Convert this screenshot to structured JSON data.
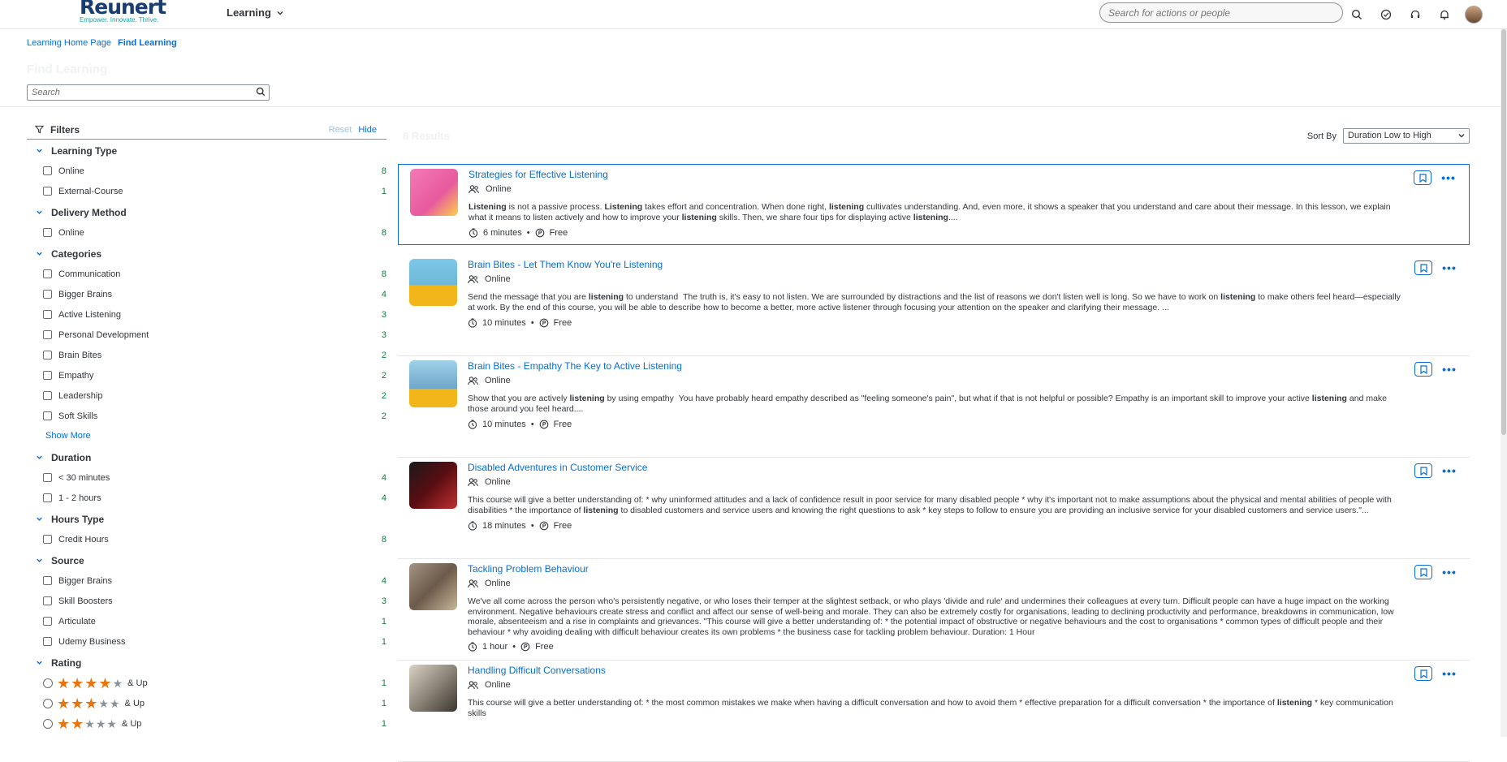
{
  "header": {
    "logo_word": "Reunert",
    "logo_tagline": "Empower. Innovate. Thrive.",
    "menu_label": "Learning",
    "search_placeholder": "Search for actions or people"
  },
  "breadcrumb": [
    "Learning Home Page",
    "Find Learning"
  ],
  "page_title": "Find Learning",
  "search": {
    "placeholder": "Search"
  },
  "filters": {
    "title": "Filters",
    "reset": "Reset",
    "hide": "Hide",
    "show_more": "Show More",
    "groups": [
      {
        "title": "Learning Type",
        "items": [
          {
            "label": "Online",
            "count": "8"
          },
          {
            "label": "External-Course",
            "count": "1"
          }
        ]
      },
      {
        "title": "Delivery Method",
        "items": [
          {
            "label": "Online",
            "count": "8"
          }
        ]
      },
      {
        "title": "Categories",
        "items": [
          {
            "label": "Communication",
            "count": "8"
          },
          {
            "label": "Bigger Brains",
            "count": "4"
          },
          {
            "label": "Active Listening",
            "count": "3"
          },
          {
            "label": "Personal Development",
            "count": "3"
          },
          {
            "label": "Brain Bites",
            "count": "2"
          },
          {
            "label": "Empathy",
            "count": "2"
          },
          {
            "label": "Leadership",
            "count": "2"
          },
          {
            "label": "Soft Skills",
            "count": "2"
          }
        ]
      },
      {
        "title": "Duration",
        "items": [
          {
            "label": "< 30 minutes",
            "count": "4"
          },
          {
            "label": "1 - 2 hours",
            "count": "4"
          }
        ]
      },
      {
        "title": "Hours Type",
        "items": [
          {
            "label": "Credit Hours",
            "count": "8"
          }
        ]
      },
      {
        "title": "Source",
        "items": [
          {
            "label": "Bigger Brains",
            "count": "4"
          },
          {
            "label": "Skill Boosters",
            "count": "3"
          },
          {
            "label": "Articulate",
            "count": "1"
          },
          {
            "label": "Udemy Business",
            "count": "1"
          }
        ]
      },
      {
        "title": "Rating",
        "items": [
          {
            "label": "& Up",
            "count": "1",
            "stars": 4
          },
          {
            "label": "& Up",
            "count": "1",
            "stars": 3
          },
          {
            "label": "& Up",
            "count": "1",
            "stars": 2
          }
        ]
      }
    ]
  },
  "results_count": "8 Results",
  "sort": {
    "label": "Sort By",
    "value": "Duration Low to High"
  },
  "results": [
    {
      "title": "Strategies for Effective Listening",
      "mode": "Online",
      "duration": "6 minutes",
      "price": "Free",
      "desc_html": "<b>Listening</b> is not a passive process. <b>Listening</b> takes effort and concentration. When done right, <b>listening</b> cultivates understanding. And, even more, it shows a speaker that you understand and care about their message. In this lesson, we explain what it means to listen actively and how to improve your <b>listening</b> skills. Then, we share four tips for displaying active <b>listening</b>...."
    },
    {
      "title": "Brain Bites - Let Them Know You're Listening",
      "mode": "Online",
      "duration": "10 minutes",
      "price": "Free",
      "desc_html": "Send the message that you are <b>listening</b> to understand &nbsp;The truth is, it's easy to not listen. We are surrounded by distractions and the list of reasons we don't listen well is long. So we have to work on <b>listening</b> to make others feel heard—especially at work. By the end of this course, you will be able to describe how to become a better, more active listener through focusing your attention on the speaker and clarifying their message. ..."
    },
    {
      "title": "Brain Bites - Empathy The Key to Active Listening",
      "mode": "Online",
      "duration": "10 minutes",
      "price": "Free",
      "desc_html": "Show that you are actively <b>listening</b> by using empathy &nbsp;You have probably heard empathy described as \"feeling someone's pain\", but what if that is not helpful or possible? Empathy is an important skill to improve your active <b>listening</b> and make those around you feel heard...."
    },
    {
      "title": "Disabled Adventures in Customer Service",
      "mode": "Online",
      "duration": "18 minutes",
      "price": "Free",
      "desc_html": "This course will give a better understanding of: * why uninformed attitudes and a lack of confidence result in poor service for many disabled people * why it's important not to make assumptions about the physical and mental abilities of people with disabilities * the importance of <b>listening</b> to disabled customers and service users and knowing the right questions to ask * key steps to follow to ensure you are providing an inclusive service for your disabled customers and service users.\"..."
    },
    {
      "title": "Tackling Problem Behaviour",
      "mode": "Online",
      "duration": "1 hour",
      "price": "Free",
      "desc_html": "We've all come across the person who's persistently negative, or who loses their temper at the slightest setback, or who plays 'divide and rule' and undermines their colleagues at every turn. Difficult people can have a huge impact on the working environment. Negative behaviours create stress and conflict and affect our sense of well-being and morale. They can also be extremely costly for organisations, leading to declining productivity and performance, breakdowns in communication, low morale, absenteeism and a rise in complaints and grievances. \"This course will give a better understanding of: * the potential impact of obstructive or negative behaviours and the cost to organisations * common types of difficult people and their behaviour * why avoiding dealing with difficult behaviour creates its own problems * the business case for tackling problem behaviour. Duration: 1 Hour"
    },
    {
      "title": "Handling Difficult Conversations",
      "mode": "Online",
      "duration": "",
      "price": "",
      "desc_html": "This course will give a better understanding of: * the most common mistakes we make when having a difficult conversation and how to avoid them * effective preparation for a difficult conversation * the importance of <b>listening</b> * key communication skills"
    }
  ],
  "colors": {
    "accent": "#0a6ed1",
    "count_green": "#107e3e",
    "star": "#e9730c"
  }
}
